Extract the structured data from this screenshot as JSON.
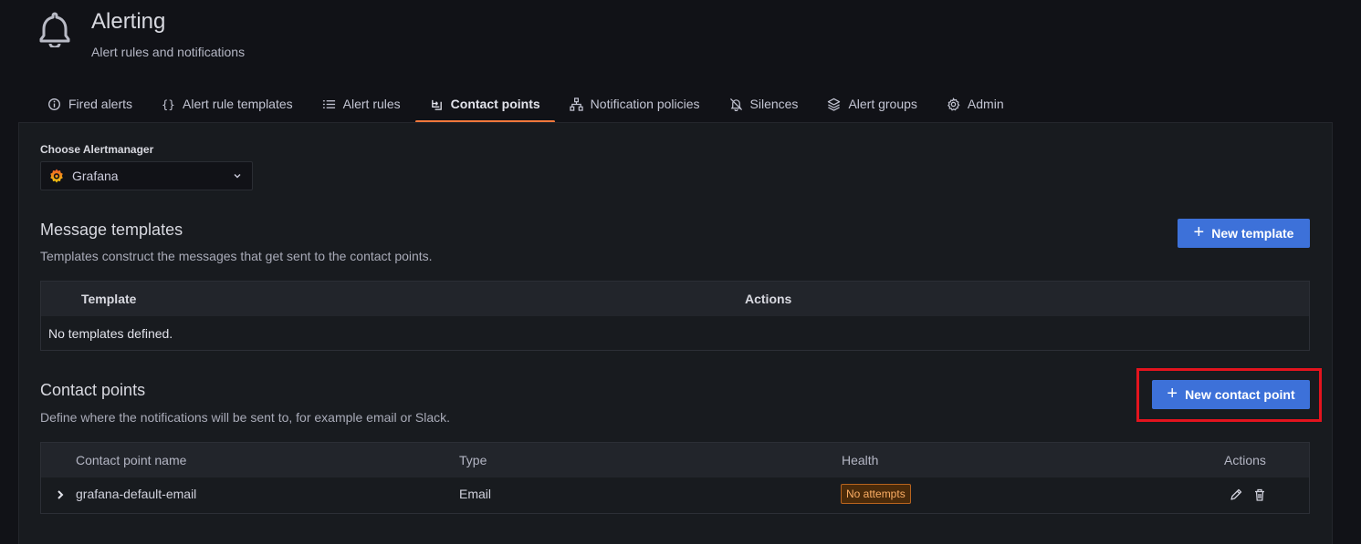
{
  "header": {
    "title": "Alerting",
    "subtitle": "Alert rules and notifications"
  },
  "tabs": [
    {
      "label": "Fired alerts",
      "icon": "info-circle-icon",
      "active": false
    },
    {
      "label": "Alert rule templates",
      "icon": "braces-icon",
      "active": false
    },
    {
      "label": "Alert rules",
      "icon": "list-icon",
      "active": false
    },
    {
      "label": "Contact points",
      "icon": "contact-icon",
      "active": true
    },
    {
      "label": "Notification policies",
      "icon": "sitemap-icon",
      "active": false
    },
    {
      "label": "Silences",
      "icon": "bell-slash-icon",
      "active": false
    },
    {
      "label": "Alert groups",
      "icon": "layers-icon",
      "active": false
    },
    {
      "label": "Admin",
      "icon": "gear-icon",
      "active": false
    }
  ],
  "alertmanager": {
    "label": "Choose Alertmanager",
    "selected": "Grafana"
  },
  "templates": {
    "title": "Message templates",
    "description": "Templates construct the messages that get sent to the contact points.",
    "new_button": "New template",
    "columns": [
      "Template",
      "Actions"
    ],
    "empty_text": "No templates defined."
  },
  "contact_points": {
    "title": "Contact points",
    "description": "Define where the notifications will be sent to, for example email or Slack.",
    "new_button": "New contact point",
    "columns": [
      "Contact point name",
      "Type",
      "Health",
      "Actions"
    ],
    "rows": [
      {
        "name": "grafana-default-email",
        "type": "Email",
        "health": "No attempts"
      }
    ]
  },
  "colors": {
    "accent": "#3d71d9",
    "active_tab_underline": "#f0783c",
    "highlight_box": "#e3141e",
    "badge_text": "#fcae64"
  }
}
